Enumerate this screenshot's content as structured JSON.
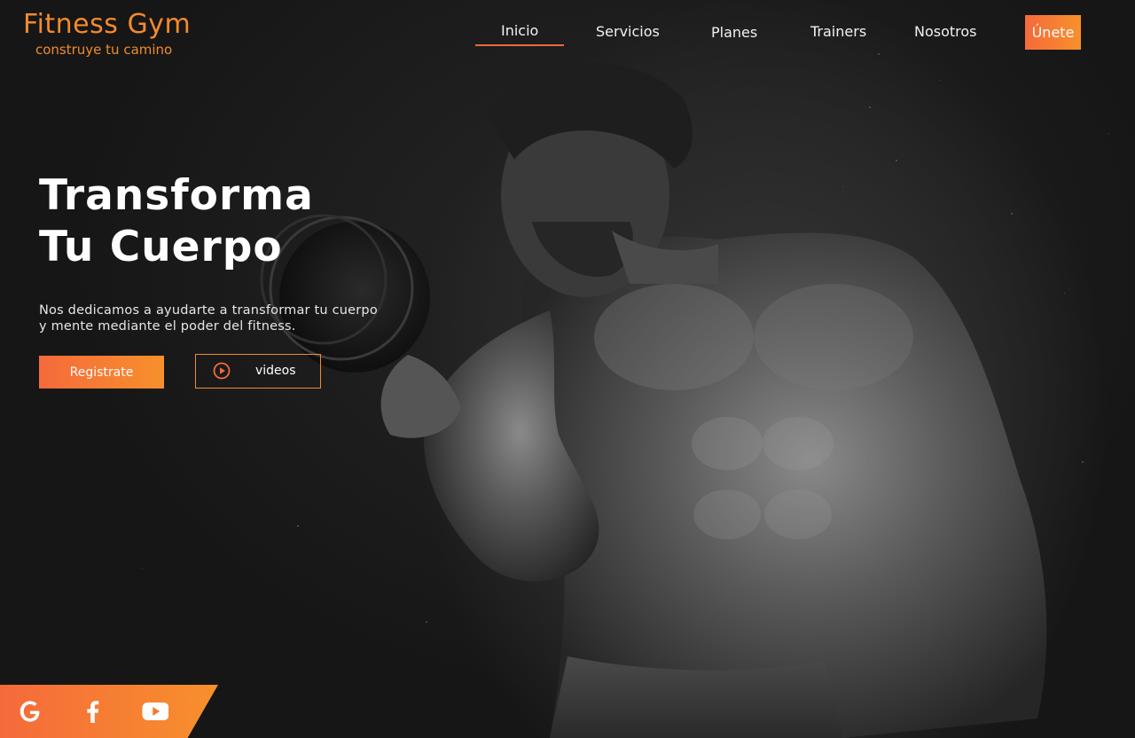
{
  "brand": {
    "title": "Fitness Gym",
    "tagline": "construye tu camino",
    "accent": "#f28a2e",
    "gradient_start": "#f56a3b",
    "gradient_end": "#f7902c"
  },
  "nav": {
    "items": [
      {
        "label": "Inicio",
        "active": true
      },
      {
        "label": "Servicios",
        "active": false
      },
      {
        "label": "Planes",
        "active": false
      },
      {
        "label": "Trainers",
        "active": false
      },
      {
        "label": "Nosotros",
        "active": false
      }
    ],
    "join_label": "Únete"
  },
  "hero": {
    "headline_line1": "Transforma",
    "headline_line2": "Tu Cuerpo",
    "description": "Nos dedicamos a ayudarte a transformar tu cuerpo y mente mediante el poder del fitness.",
    "register_label": "Registrate",
    "videos_label": "videos",
    "image_subject": "shirtless bodybuilder lifting a dumbbell, monochrome"
  },
  "social": {
    "icons": [
      "google-icon",
      "facebook-icon",
      "youtube-icon"
    ]
  }
}
